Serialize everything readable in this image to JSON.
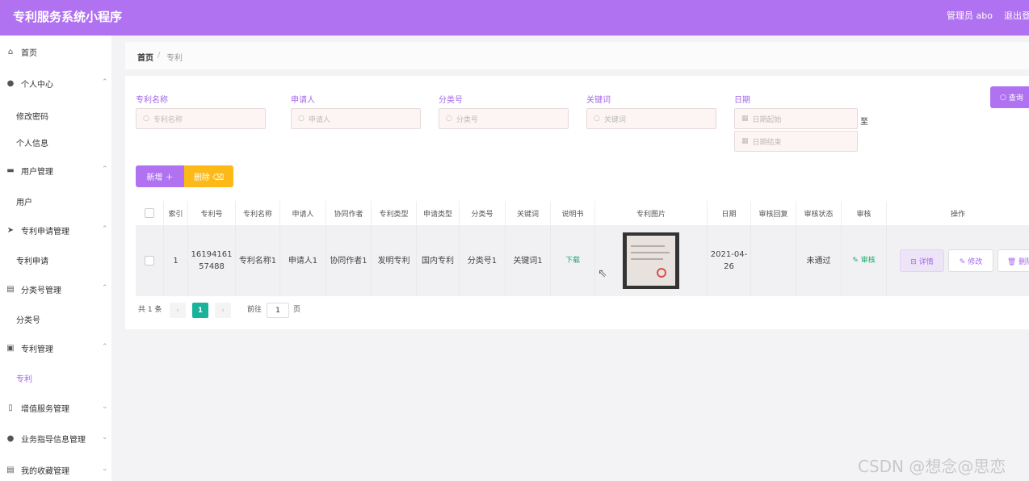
{
  "app": {
    "title": "专利服务系统小程序",
    "user": "管理员 abo",
    "logout": "退出登"
  },
  "sidebar": {
    "items": [
      {
        "label": "首页",
        "icon": "home-icon"
      },
      {
        "label": "个人中心",
        "icon": "user-icon"
      },
      {
        "label": "用户管理",
        "icon": "folder-icon"
      },
      {
        "label": "专利申请管理",
        "icon": "send-icon"
      },
      {
        "label": "分类号管理",
        "icon": "doc-icon"
      },
      {
        "label": "专利管理",
        "icon": "chart-icon"
      },
      {
        "label": "增值服务管理",
        "icon": "phone-icon"
      },
      {
        "label": "业务指导信息管理",
        "icon": "pin-icon"
      },
      {
        "label": "我的收藏管理",
        "icon": "doc-icon"
      }
    ],
    "subs": [
      "修改密码",
      "个人信息",
      "用户",
      "专利申请",
      "分类号",
      "专利"
    ]
  },
  "breadcrumb": {
    "home": "首页",
    "sep": "/",
    "current": "专利"
  },
  "search": {
    "name_label": "专利名称",
    "name_placeholder": "专利名称",
    "applicant_label": "申请人",
    "applicant_placeholder": "申请人",
    "class_label": "分类号",
    "class_placeholder": "分类号",
    "keyword_label": "关键词",
    "keyword_placeholder": "关键词",
    "date_label": "日期",
    "date_start": "日期起始",
    "date_end": "日期结束",
    "to": "至",
    "query_btn": "查询"
  },
  "actions": {
    "add": "新增 ＋",
    "delete": "删除 ⌫"
  },
  "table": {
    "headers": [
      "索引",
      "专利号",
      "专利名称",
      "申请人",
      "协同作者",
      "专利类型",
      "申请类型",
      "分类号",
      "关键词",
      "说明书",
      "专利图片",
      "日期",
      "审核回复",
      "审核状态",
      "审核",
      "操作"
    ],
    "row": {
      "index": "1",
      "patent_no": "1619416157488",
      "patent_name": "专利名称1",
      "applicant": "申请人1",
      "coauthor": "协同作者1",
      "patent_type": "发明专利",
      "apply_type": "国内专利",
      "class_no": "分类号1",
      "keyword": "关键词1",
      "manual": "下载",
      "date": "2021-04-26",
      "reply": "",
      "status": "未通过",
      "review": "✎ 审核",
      "op_detail": "⊟ 详情",
      "op_edit": "✎ 修改",
      "op_delete": "🗑 删除"
    }
  },
  "pagination": {
    "total": "共 1 条",
    "current": "1",
    "goto": "前往",
    "page_input": "1",
    "page_unit": "页"
  },
  "watermark": "CSDN @想念@思恋"
}
